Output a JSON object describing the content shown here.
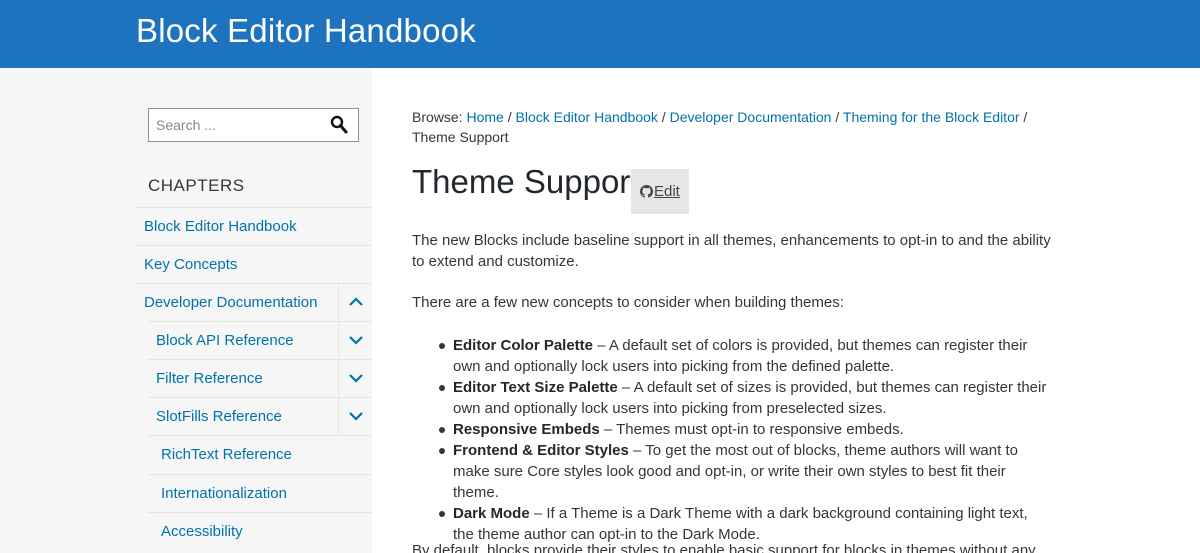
{
  "header": {
    "site_title": "Block Editor Handbook"
  },
  "search": {
    "placeholder": "Search ..."
  },
  "sidebar": {
    "chapters_heading": "CHAPTERS",
    "items": [
      {
        "label": "Block Editor Handbook"
      },
      {
        "label": "Key Concepts"
      },
      {
        "label": "Developer Documentation",
        "state": "expanded"
      },
      {
        "label": "Block API Reference",
        "state": "collapsed"
      },
      {
        "label": "Filter Reference",
        "state": "collapsed"
      },
      {
        "label": "SlotFills Reference",
        "state": "collapsed"
      },
      {
        "label": "RichText Reference"
      },
      {
        "label": "Internationalization"
      },
      {
        "label": "Accessibility"
      }
    ]
  },
  "breadcrumb": {
    "prefix": "Browse:",
    "links": [
      "Home",
      "Block Editor Handbook",
      "Developer Documentation",
      "Theming for the Block Editor"
    ],
    "current": "Theme Support"
  },
  "page": {
    "title": "Theme Support",
    "edit_label": "Edit",
    "intro": "The new Blocks include baseline support in all themes, enhancements to opt-in to and the ability to extend and customize.",
    "concepts_intro": "There are a few new concepts to consider when building themes:",
    "concepts": [
      {
        "term": "Editor Color Palette",
        "text": " – A default set of colors is provided, but themes can register their own and optionally lock users into picking from the defined palette."
      },
      {
        "term": "Editor Text Size Palette",
        "text": " – A default set of sizes is provided, but themes can register their own and optionally lock users into picking from preselected sizes."
      },
      {
        "term": "Responsive Embeds",
        "text": " – Themes must opt-in to responsive embeds."
      },
      {
        "term": "Frontend & Editor Styles",
        "text": " – To get the most out of blocks, theme authors will want to make sure Core styles look good and opt-in, or write their own styles to best fit their theme."
      },
      {
        "term": "Dark Mode",
        "text": " – If a Theme is a Dark Theme with a dark background containing light text, the theme author can opt-in to the Dark Mode."
      }
    ],
    "cutoff": "By default, blocks provide their styles to enable basic support for blocks in themes without any"
  },
  "colors": {
    "header_bg": "#1e73be",
    "link": "#0073aa",
    "sidebar_bg": "#f6f6f6"
  }
}
